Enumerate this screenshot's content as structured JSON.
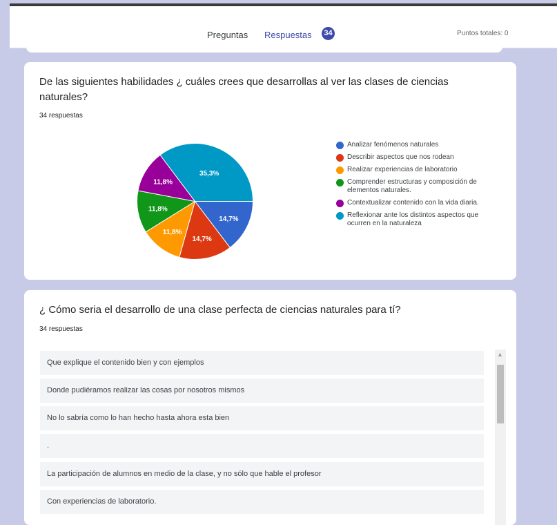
{
  "header": {
    "tabs": [
      {
        "label": "Preguntas"
      },
      {
        "label": "Respuestas"
      }
    ],
    "badge": "34",
    "points": "Puntos totales: 0"
  },
  "question1": {
    "title": "De las siguientes habilidades ¿ cuáles crees que desarrollas al ver las clases de ciencias naturales?",
    "responses": "34 respuestas"
  },
  "chart_data": {
    "type": "pie",
    "categories": [
      "Analizar fenómenos naturales",
      "Describir aspectos que nos rodean",
      "Realizar experiencias de laboratorio",
      "Comprender estructuras y composición de elementos naturales.",
      "Contextualizar contenido con la vida diaria.",
      "Reflexionar ante los distintos aspectos que ocurren en la naturaleza"
    ],
    "values": [
      14.7,
      14.7,
      11.8,
      11.8,
      11.8,
      35.3
    ],
    "labels": [
      "14,7%",
      "14,7%",
      "11,8%",
      "11,8%",
      "11,8%",
      "35,3%"
    ],
    "colors": [
      "#3366cc",
      "#dc3912",
      "#ff9900",
      "#109618",
      "#990099",
      "#0099c6"
    ],
    "legend": "right"
  },
  "question2": {
    "title": "¿ Cómo seria el desarrollo de una clase perfecta de ciencias naturales para tí?",
    "responses": "34 respuestas",
    "answers": [
      "Que explique el contenido bien y con ejemplos",
      "Donde pudiéramos realizar las cosas por nosotros mismos",
      "No lo sabría como lo han hecho hasta ahora esta bien",
      ".",
      "La participación de alumnos en medio de la clase, y no sólo que hable el profesor",
      "Con experiencias de laboratorio."
    ]
  },
  "scrollbar": {
    "up_icon": "▲"
  }
}
